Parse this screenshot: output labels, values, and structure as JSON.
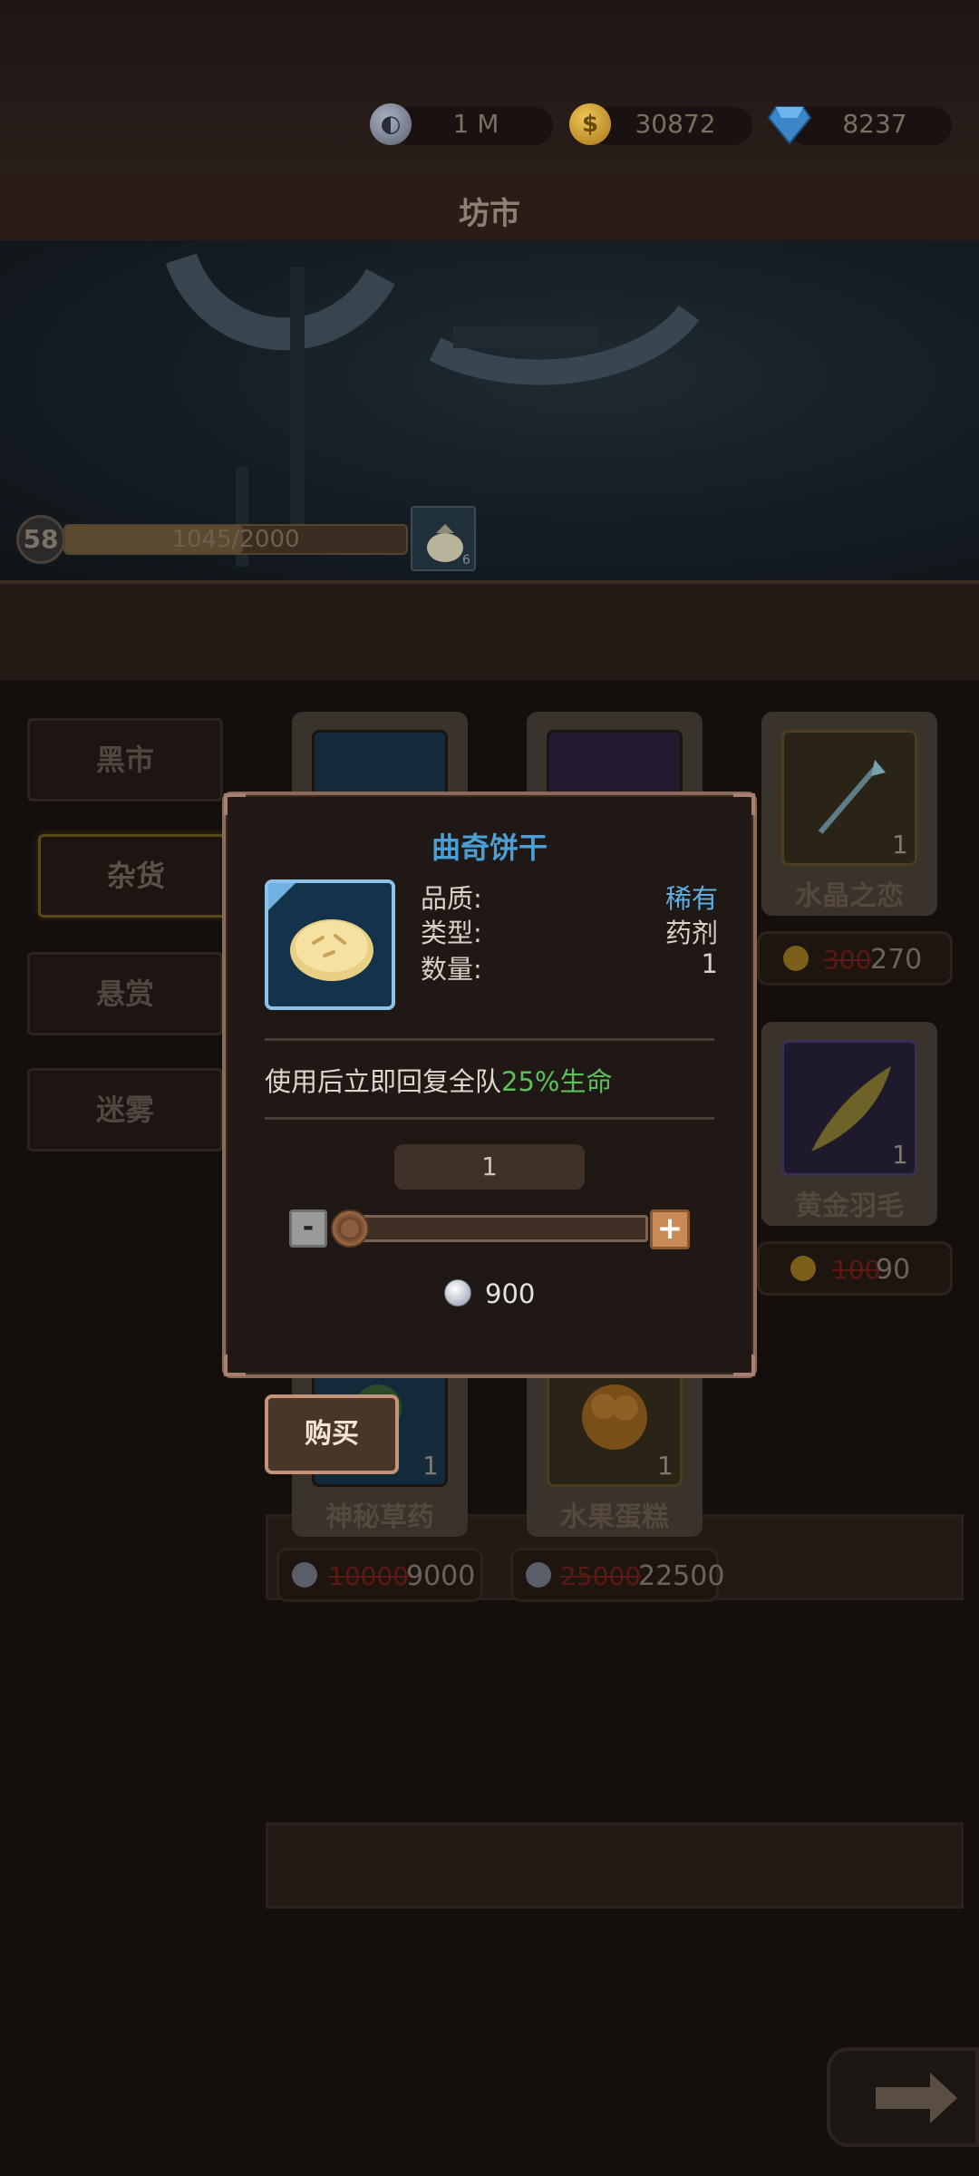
{
  "currencies": [
    {
      "name": "silver-coin",
      "value": "1 M",
      "color": "#8a92a6"
    },
    {
      "name": "gold-coin",
      "value": "30872",
      "color": "#d8a22a"
    },
    {
      "name": "diamond",
      "value": "8237",
      "color": "#3a8cd6"
    }
  ],
  "header": {
    "title": "坊市"
  },
  "player": {
    "level": "58",
    "xp": "1045/2000",
    "xp_progress": 0.5225,
    "bag_count": "6"
  },
  "nav": {
    "items": [
      {
        "label": "黑市"
      },
      {
        "label": "杂货",
        "active": true
      },
      {
        "label": "悬赏"
      },
      {
        "label": "迷雾"
      }
    ]
  },
  "shop": {
    "items": [
      {
        "name": "",
        "count": "",
        "currency": "",
        "old_price": "",
        "new_price": ""
      },
      {
        "name": "",
        "count": "",
        "currency": "",
        "old_price": "",
        "new_price": ""
      },
      {
        "name": "水晶之恋",
        "count": "1",
        "currency": "gold",
        "old_price": "300",
        "new_price": "270"
      },
      {
        "name": "黄金羽毛",
        "count": "1",
        "currency": "gold",
        "old_price": "100",
        "new_price": "90"
      },
      {
        "name": "神秘草药",
        "count": "1",
        "currency": "silver",
        "old_price": "10000",
        "new_price": "9000"
      },
      {
        "name": "水果蛋糕",
        "count": "1",
        "currency": "silver",
        "old_price": "25000",
        "new_price": "22500"
      }
    ]
  },
  "dialog": {
    "title": "曲奇饼干",
    "quality_label": "品质:",
    "quality_value": "稀有",
    "type_label": "类型:",
    "type_value": "药剂",
    "qty_label": "数量:",
    "qty_value": "1",
    "desc_prefix": "使用后立即回复全队",
    "desc_highlight": "25%生命",
    "selected_qty": "1",
    "minus_label": "-",
    "plus_label": "+",
    "cost": "900",
    "slider_position": 0
  },
  "buy_button": {
    "label": "购买"
  }
}
